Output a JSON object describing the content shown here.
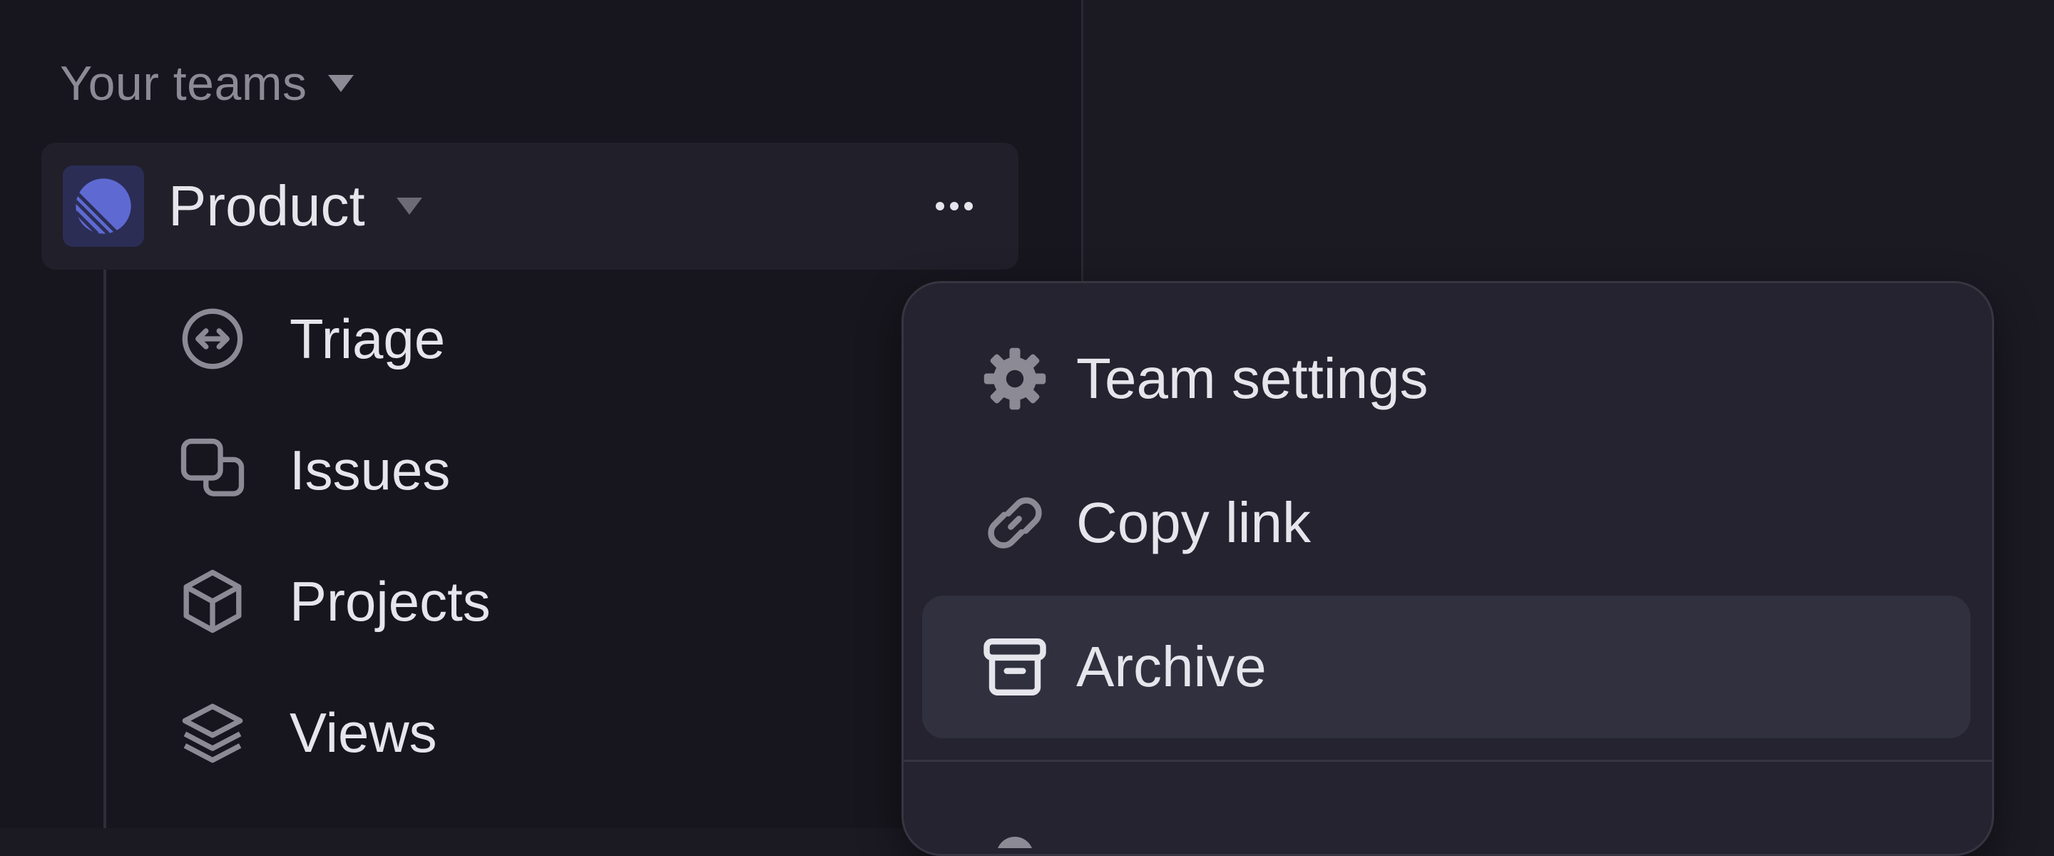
{
  "sidebar": {
    "section_title": "Your teams",
    "team": {
      "name": "Product",
      "avatar_icon": "linear-logo-icon",
      "avatar_color": "#5e6ad2"
    },
    "nav_items": [
      {
        "label": "Triage",
        "icon": "triage-icon"
      },
      {
        "label": "Issues",
        "icon": "issues-icon"
      },
      {
        "label": "Projects",
        "icon": "projects-icon"
      },
      {
        "label": "Views",
        "icon": "views-icon"
      }
    ]
  },
  "context_menu": {
    "items": [
      {
        "label": "Team settings",
        "icon": "gear-icon"
      },
      {
        "label": "Copy link",
        "icon": "link-icon"
      },
      {
        "label": "Archive",
        "icon": "archive-icon",
        "highlighted": true
      }
    ]
  },
  "colors": {
    "background": "#1b1a23",
    "sidebar": "#17161e",
    "menu": "#24232f",
    "highlight": "#30303f",
    "text": "#e6e5ec",
    "muted": "#8c8a95",
    "accent": "#5e6ad2"
  }
}
